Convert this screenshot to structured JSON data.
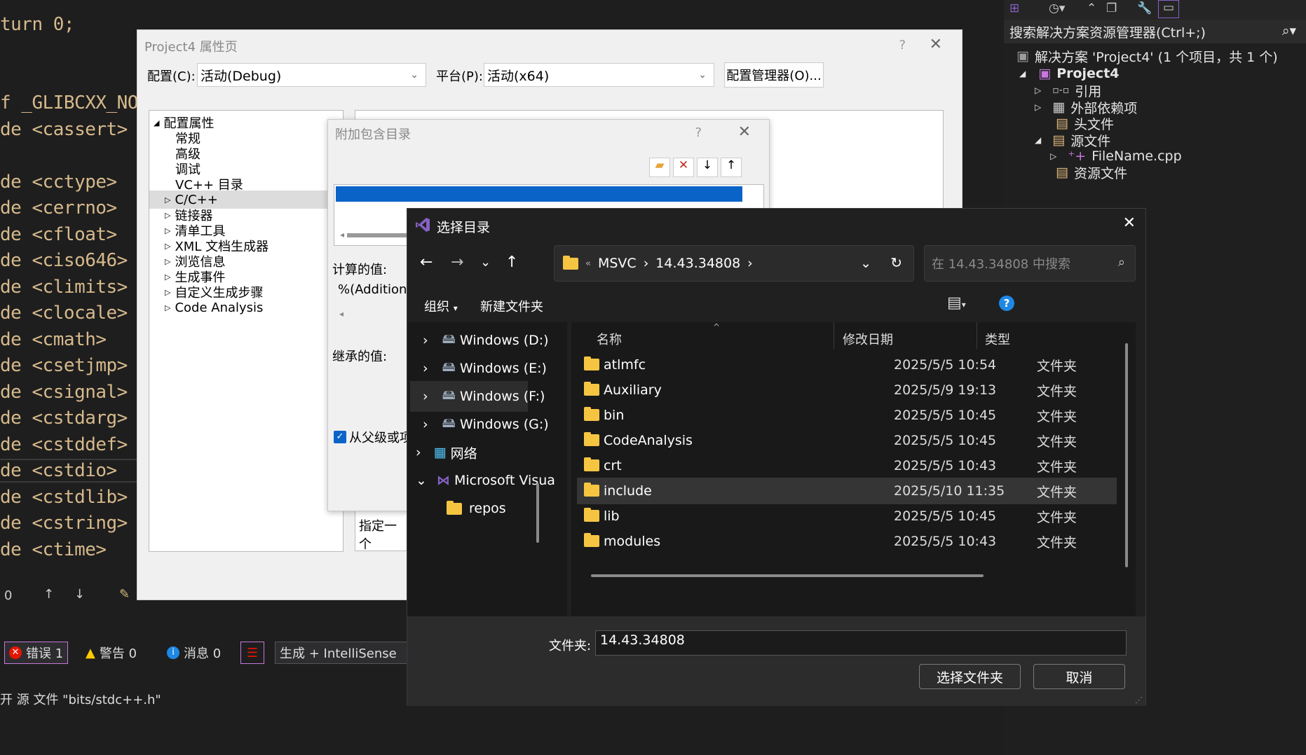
{
  "editor": {
    "lines": [
      "turn 0;",
      "f _GLIBCXX_NO",
      "de <cassert>",
      "de <cctype>",
      "de <cerrno>",
      "de <cfloat>",
      "de <ciso646>",
      "de <climits>",
      "de <clocale>",
      "de <cmath>",
      "de <csetjmp>",
      "de <csignal>",
      "de <cstdarg>",
      "de <cstddef>",
      "de <cstdio>",
      "de <cstdlib>",
      "de <cstring>",
      "de <ctime>"
    ],
    "status_count": "0"
  },
  "error_list": {
    "errors": "错误 1",
    "warnings": "警告 0",
    "messages": "消息 0",
    "build_filter": "生成 + IntelliSense"
  },
  "output": {
    "text": "开 源 文件 \"bits/stdc++.h\""
  },
  "solution_explorer": {
    "search_placeholder": "搜索解决方案资源管理器(Ctrl+;)",
    "solution": "解决方案 'Project4' (1 个项目，共 1 个)",
    "project": "Project4",
    "items": [
      "引用",
      "外部依赖项",
      "头文件",
      "源文件",
      "FileName.cpp",
      "资源文件"
    ]
  },
  "property_page": {
    "title": "Project4 属性页",
    "help": "?",
    "config_label": "配置(C):",
    "config_value": "活动(Debug)",
    "platform_label": "平台(P):",
    "platform_value": "活动(x64)",
    "config_manager": "配置管理器(O)...",
    "tree": {
      "root": "配置属性",
      "items": [
        "常规",
        "高级",
        "调试",
        "VC++ 目录",
        "C/C++",
        "链接器",
        "清单工具",
        "XML 文档生成器",
        "浏览信息",
        "生成事件",
        "自定义生成步骤",
        "Code Analysis"
      ],
      "selected": "C/C++"
    },
    "desc_partial": "指定一个"
  },
  "include_dialog": {
    "title": "附加包含目录",
    "help": "?",
    "computed_label": "计算的值:",
    "computed_value": "%(Addition",
    "inherited_label": "继承的值:",
    "checkbox_label": "从父级或项"
  },
  "select_dir": {
    "title": "选择目录",
    "breadcrumb": [
      "MSVC",
      "14.43.34808"
    ],
    "search_placeholder": "在 14.43.34808 中搜索",
    "organize": "组织",
    "new_folder": "新建文件夹",
    "nav": [
      {
        "label": "Windows (D:)",
        "icon": "drive-icon"
      },
      {
        "label": "Windows (E:)",
        "icon": "drive-icon"
      },
      {
        "label": "Windows (F:)",
        "icon": "drive-icon"
      },
      {
        "label": "Windows (G:)",
        "icon": "drive-icon"
      },
      {
        "label": "网络",
        "icon": "network-icon"
      },
      {
        "label": "Microsoft Visua",
        "icon": "vs-icon"
      },
      {
        "label": "repos",
        "icon": "folder-icon"
      }
    ],
    "columns": {
      "name": "名称",
      "date": "修改日期",
      "type": "类型"
    },
    "files": [
      {
        "name": "atlmfc",
        "date": "2025/5/5 10:54",
        "type": "文件夹"
      },
      {
        "name": "Auxiliary",
        "date": "2025/5/9 19:13",
        "type": "文件夹"
      },
      {
        "name": "bin",
        "date": "2025/5/5 10:45",
        "type": "文件夹"
      },
      {
        "name": "CodeAnalysis",
        "date": "2025/5/5 10:45",
        "type": "文件夹"
      },
      {
        "name": "crt",
        "date": "2025/5/5 10:43",
        "type": "文件夹"
      },
      {
        "name": "include",
        "date": "2025/5/10 11:35",
        "type": "文件夹"
      },
      {
        "name": "lib",
        "date": "2025/5/5 10:45",
        "type": "文件夹"
      },
      {
        "name": "modules",
        "date": "2025/5/5 10:43",
        "type": "文件夹"
      }
    ],
    "selected_file": "include",
    "folder_label": "文件夹:",
    "folder_value": "14.43.34808",
    "select_button": "选择文件夹",
    "cancel_button": "取消"
  },
  "colors": {
    "accent": "#0078d4",
    "vs_purple": "#8661c5",
    "folder": "#f5c542"
  }
}
